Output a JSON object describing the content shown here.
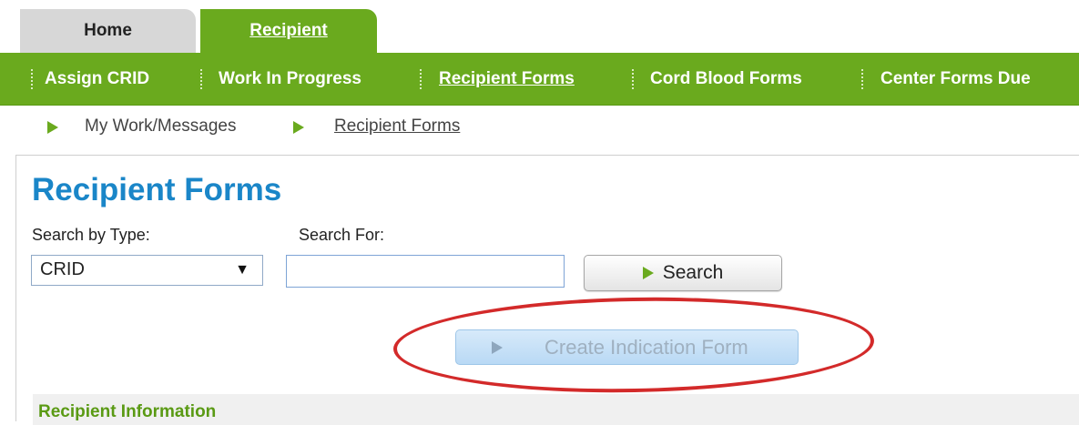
{
  "tabs": {
    "home": "Home",
    "recipient": "Recipient"
  },
  "nav": {
    "items": [
      {
        "label": "Assign CRID"
      },
      {
        "label": "Work In Progress"
      },
      {
        "label": "Recipient Forms"
      },
      {
        "label": "Cord Blood Forms"
      },
      {
        "label": "Center Forms Due"
      }
    ]
  },
  "breadcrumb": {
    "items": [
      "My Work/Messages",
      "Recipient Forms"
    ]
  },
  "page": {
    "title": "Recipient Forms",
    "search_by_type_label": "Search by Type:",
    "search_for_label": "Search For:",
    "search_type_value": "CRID",
    "search_button_label": "Search",
    "create_button_label": "Create Indication Form",
    "section_title": "Recipient Information"
  },
  "colors": {
    "accent_green": "#6aaa1e",
    "title_blue": "#1a86c8",
    "highlight_red": "#d32a2a"
  }
}
